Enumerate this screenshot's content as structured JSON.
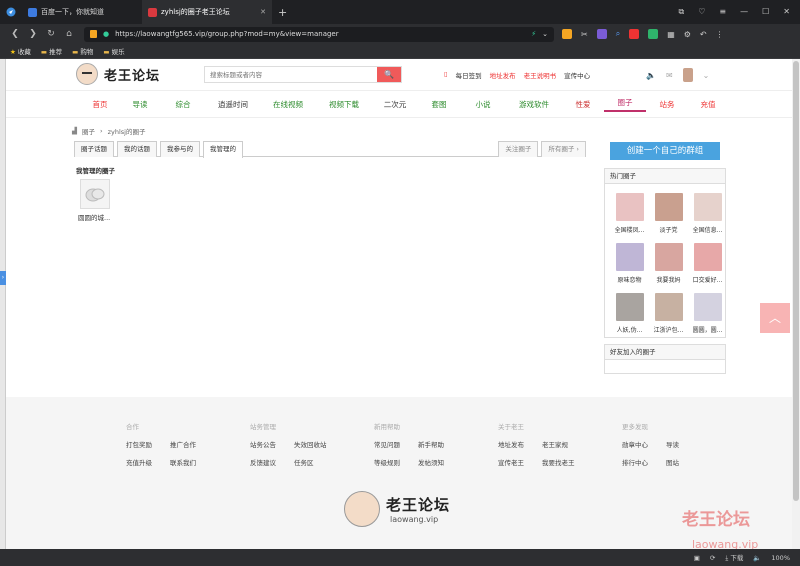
{
  "browser": {
    "tabs": [
      {
        "title": "百度一下，你就知道",
        "color": "#3d7be0"
      },
      {
        "title": "zyhlsj的圈子老王论坛",
        "color": "#d9393f"
      }
    ],
    "url": "https://laowangtfg565.vip/group.php?mod=my&view=manager",
    "bookmarks": [
      "收藏",
      "推荐",
      "购物",
      "娱乐"
    ],
    "status_zoom": "100%",
    "status_download": "下载"
  },
  "site": {
    "logo_text": "老王论坛",
    "search_placeholder": "搜索标题或者内容",
    "search_btn": "🔍",
    "toplinks": [
      "每日签到",
      "地址发布",
      "老王说明书",
      "宣传中心"
    ],
    "nav": [
      {
        "label": "首页",
        "color": "#e33"
      },
      {
        "label": "导读",
        "color": "#2a8a2a"
      },
      {
        "label": "综合",
        "color": "#2a8a2a"
      },
      {
        "label": "逍遥时间",
        "color": "#333"
      },
      {
        "label": "在线视频",
        "color": "#2a8a2a"
      },
      {
        "label": "视频下载",
        "color": "#2a8a2a"
      },
      {
        "label": "二次元",
        "color": "#333"
      },
      {
        "label": "套图",
        "color": "#2a8a2a"
      },
      {
        "label": "小说",
        "color": "#2a8a2a"
      },
      {
        "label": "游戏软件",
        "color": "#2a8a2a"
      },
      {
        "label": "性爱",
        "color": "#c33"
      },
      {
        "label": "圈子",
        "color": "#c0306a"
      },
      {
        "label": "站务",
        "color": "#e33"
      },
      {
        "label": "充值",
        "color": "#e33"
      }
    ]
  },
  "breadcrumb": [
    "圈子",
    "zyhlsj的圈子"
  ],
  "tabs": {
    "left": [
      "圈子话题",
      "我的话题",
      "我参与的",
      "我管理的"
    ],
    "active": "我管理的",
    "right": [
      "关注圈子",
      "所有圈子 ›"
    ]
  },
  "managed": {
    "title": "我管理的圈子",
    "groups": [
      {
        "name": "圆圆的城..."
      }
    ]
  },
  "sidebar": {
    "create_btn": "创建一个自己的群组",
    "hot_title": "热门圈子",
    "hot": [
      {
        "name": "全国楼凤...",
        "color": "#e9c2c2"
      },
      {
        "name": "淡子党",
        "color": "#c9a08f"
      },
      {
        "name": "全国信息...",
        "color": "#e6d2cc"
      },
      {
        "name": "原味恋物",
        "color": "#bfb6d6"
      },
      {
        "name": "我要我妈",
        "color": "#d8a6a0"
      },
      {
        "name": "口交爱好...",
        "color": "#e7a8a8"
      },
      {
        "name": "人妖,伪...",
        "color": "#a9a4a0"
      },
      {
        "name": "江浙沪包...",
        "color": "#c7b1a2"
      },
      {
        "name": "圆圆，圆...",
        "color": "#d4d2e0"
      }
    ],
    "friends_title": "好友加入的圈子",
    "totop": "︿"
  },
  "footer": {
    "cols": [
      {
        "title": "合作",
        "rows": [
          [
            "打包奖励",
            "推广合作"
          ],
          [
            "充值升级",
            "联系我们"
          ]
        ]
      },
      {
        "title": "站务管理",
        "rows": [
          [
            "站务公告",
            "失效回收站"
          ],
          [
            "反馈建议",
            "任务区"
          ]
        ]
      },
      {
        "title": "新用帮助",
        "rows": [
          [
            "常见问题",
            "新手帮助"
          ],
          [
            "等级规则",
            "发帖须知"
          ]
        ]
      },
      {
        "title": "关于老王",
        "rows": [
          [
            "地址发布",
            "老王家规"
          ],
          [
            "宣传老王",
            "我要找老王"
          ]
        ]
      },
      {
        "title": "更多发现",
        "rows": [
          [
            "勋章中心",
            "导读"
          ],
          [
            "排行中心",
            "图站"
          ]
        ]
      }
    ],
    "logo_text": "老王论坛",
    "logo_domain": "laowang.vip"
  },
  "watermark": {
    "line1": "老王论坛",
    "line2": "laowang.vip"
  }
}
